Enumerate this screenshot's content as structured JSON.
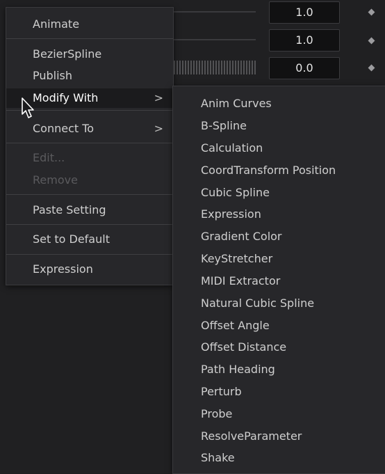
{
  "inspector": {
    "rows": [
      {
        "value": "1.0"
      },
      {
        "value": "1.0"
      },
      {
        "value": "0.0"
      }
    ]
  },
  "context_menu": {
    "items": [
      {
        "label": "Animate",
        "enabled": true
      },
      {
        "label": "BezierSpline",
        "enabled": true
      },
      {
        "label": "Publish",
        "enabled": true
      },
      {
        "label": "Modify With",
        "enabled": true,
        "has_submenu": true,
        "highlighted": true
      },
      {
        "label": "Connect To",
        "enabled": true,
        "has_submenu": true
      },
      {
        "label": "Edit...",
        "enabled": false
      },
      {
        "label": "Remove",
        "enabled": false
      },
      {
        "label": "Paste Setting",
        "enabled": true
      },
      {
        "label": "Set to Default",
        "enabled": true
      },
      {
        "label": "Expression",
        "enabled": true
      }
    ],
    "submenu_chevron": ">"
  },
  "submenu": {
    "items": [
      "Anim Curves",
      "B-Spline",
      "Calculation",
      "CoordTransform Position",
      "Cubic Spline",
      "Expression",
      "Gradient Color",
      "KeyStretcher",
      "MIDI Extractor",
      "Natural Cubic Spline",
      "Offset Angle",
      "Offset Distance",
      "Path Heading",
      "Perturb",
      "Probe",
      "ResolveParameter",
      "Shake"
    ]
  },
  "colors": {
    "background": "#202022",
    "menu": "#27272a",
    "highlight": "#1b1b1d",
    "text": "#cfcfcf",
    "disabled_text": "#5a5a5d"
  }
}
